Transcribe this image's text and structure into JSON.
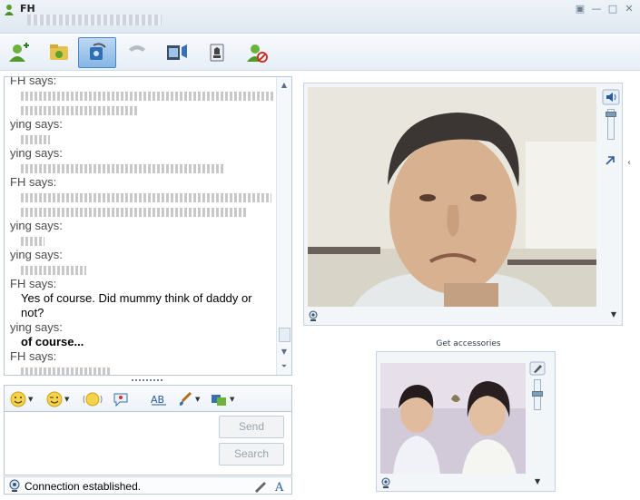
{
  "window": {
    "title": "FH",
    "controls": [
      "minimize-to-tray",
      "minimize",
      "maximize",
      "close"
    ]
  },
  "toolbar": {
    "buttons": [
      {
        "id": "invite",
        "icon": "add-contact-icon",
        "active": false
      },
      {
        "id": "send-files",
        "icon": "send-file-icon",
        "active": false
      },
      {
        "id": "webcam-call",
        "icon": "webcam-call-icon",
        "active": true
      },
      {
        "id": "call",
        "icon": "phone-icon",
        "active": false
      },
      {
        "id": "activities",
        "icon": "activities-icon",
        "active": false
      },
      {
        "id": "games",
        "icon": "games-icon",
        "active": false
      },
      {
        "id": "block",
        "icon": "block-contact-icon",
        "active": false
      }
    ]
  },
  "conversation": [
    {
      "sender": "FH says:",
      "lines": [
        "",
        ""
      ]
    },
    {
      "sender": "ying says:",
      "lines": [
        ""
      ]
    },
    {
      "sender": "ying says:",
      "lines": [
        ""
      ]
    },
    {
      "sender": "FH says:",
      "lines": [
        "",
        ""
      ]
    },
    {
      "sender": "ying says:",
      "lines": [
        ""
      ]
    },
    {
      "sender": "ying says:",
      "lines": [
        ""
      ]
    },
    {
      "sender": "FH says:",
      "lines": [
        "Yes of course.  Did mummy think of daddy or",
        "not?"
      ]
    },
    {
      "sender": "ying says:",
      "lines": [
        "of course..."
      ],
      "bold": true
    },
    {
      "sender": "FH says:",
      "lines": [
        ""
      ]
    }
  ],
  "compose": {
    "send_label": "Send",
    "search_label": "Search"
  },
  "status": {
    "text": "Connection established."
  },
  "video": {
    "accessories_label": "Get accessories"
  },
  "colors": {
    "accent": "#4a86c6",
    "border": "#b9c7d6",
    "toolbar_bg": "#e7eef6"
  }
}
